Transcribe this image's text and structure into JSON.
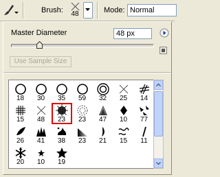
{
  "options_bar": {
    "tool_icon": "brush-tool-icon",
    "brush_label": "Brush:",
    "brush_size": "48",
    "mode_label": "Mode:",
    "mode_value": "Normal"
  },
  "picker": {
    "diameter_label": "Master Diameter",
    "diameter_value": "48 px",
    "diameter_fraction": 0.2,
    "sample_button_label": "Use Sample Size",
    "selected_index": 9,
    "brushes": [
      {
        "glyph": "hard-round",
        "size": "18"
      },
      {
        "glyph": "hard-round",
        "size": "30"
      },
      {
        "glyph": "hard-round",
        "size": "35"
      },
      {
        "glyph": "hard-round",
        "size": "59"
      },
      {
        "glyph": "double-ring",
        "size": "32"
      },
      {
        "glyph": "x-cross",
        "size": "25"
      },
      {
        "glyph": "hatch",
        "size": "14"
      },
      {
        "glyph": "grid-hash",
        "size": "15"
      },
      {
        "glyph": "x-cross",
        "size": "48"
      },
      {
        "glyph": "dark-star",
        "size": "23"
      },
      {
        "glyph": "spiral",
        "size": "23"
      },
      {
        "glyph": "fan",
        "size": "47"
      },
      {
        "glyph": "diamond",
        "size": "10"
      },
      {
        "glyph": "arrows",
        "size": "77"
      },
      {
        "glyph": "leaf",
        "size": "26"
      },
      {
        "glyph": "cluster",
        "size": "41"
      },
      {
        "glyph": "splat",
        "size": "38"
      },
      {
        "glyph": "gradient-wedge",
        "size": "23"
      },
      {
        "glyph": "comma",
        "size": "21"
      },
      {
        "glyph": "squiggle",
        "size": "15"
      },
      {
        "glyph": "slash",
        "size": "11"
      },
      {
        "glyph": "snowflake",
        "size": "20"
      },
      {
        "glyph": "small-star",
        "size": "10"
      },
      {
        "glyph": "star",
        "size": "19"
      }
    ]
  }
}
